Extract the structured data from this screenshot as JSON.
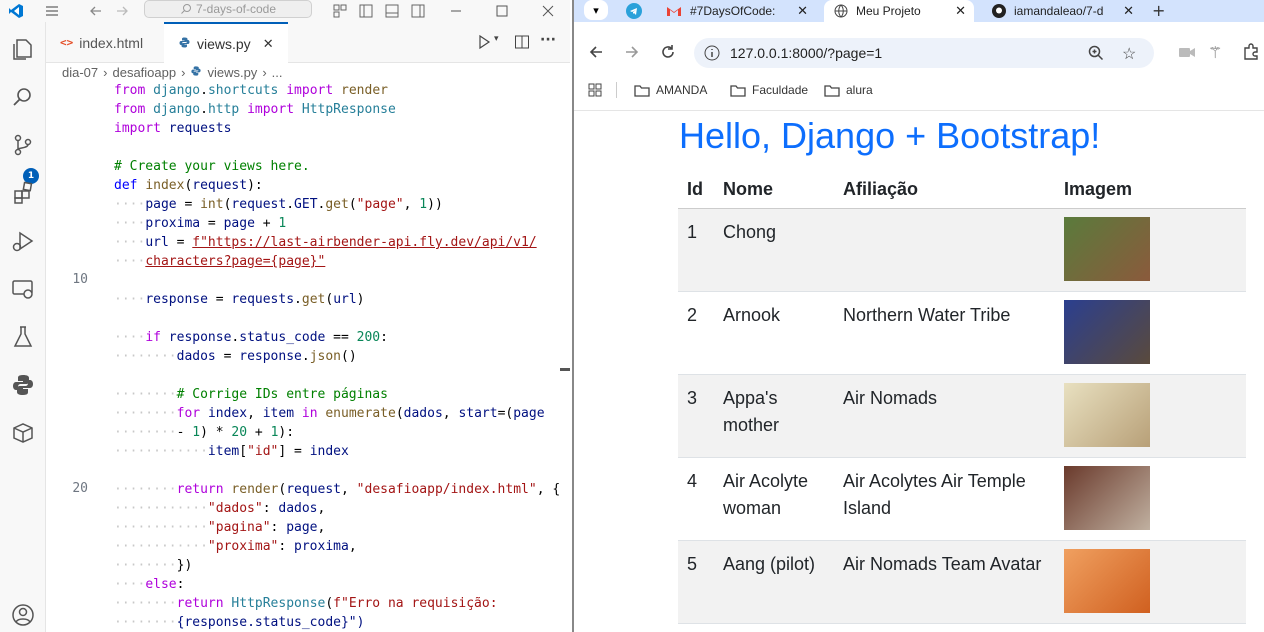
{
  "vscode": {
    "command_center": "7-days-of-code",
    "tabs": [
      {
        "label": "index.html",
        "icon": "html-file-icon"
      },
      {
        "label": "views.py",
        "icon": "python-file-icon"
      }
    ],
    "breadcrumb": [
      "dia-07",
      "desafioapp",
      "views.py",
      "..."
    ],
    "scm_badge": "1",
    "line_numbers": [
      {
        "label": "10"
      },
      {
        "label": "20"
      }
    ],
    "code_lines": [
      "from django.shortcuts import render",
      "from django.http import HttpResponse",
      "import requests",
      "",
      "# Create your views here.",
      "def index(request):",
      "    page = int(request.GET.get(\"page\", 1))",
      "    proxima = page + 1",
      "    url = f\"https://last-airbender-api.fly.dev/api/v1/",
      "    characters?page={page}\"",
      "",
      "    response = requests.get(url)",
      "",
      "    if response.status_code == 200:",
      "        dados = response.json()",
      "",
      "        # Corrige IDs entre páginas",
      "        for index, item in enumerate(dados, start=(page",
      "        - 1) * 20 + 1):",
      "            item[\"id\"] = index",
      "",
      "        return render(request, \"desafioapp/index.html\", {",
      "            \"dados\": dados,",
      "            \"pagina\": page,",
      "            \"proxima\": proxima,",
      "        })",
      "    else:",
      "        return HttpResponse(f\"Erro na requisição:",
      "        {response.status_code}\")"
    ]
  },
  "chrome": {
    "tabs": [
      {
        "label": "#7DaysOfCode: ",
        "icon": "gmail-icon"
      },
      {
        "label": "Meu Projeto",
        "icon": "globe-icon",
        "active": true
      },
      {
        "label": "iamandaleao/7-d",
        "icon": "github-icon"
      }
    ],
    "url": "127.0.0.1:8000/?page=1",
    "bookmarks": [
      {
        "label": "AMANDA"
      },
      {
        "label": "Faculdade"
      },
      {
        "label": "alura"
      }
    ]
  },
  "page": {
    "title": "Hello, Django + Bootstrap!",
    "table": {
      "headers": [
        "Id",
        "Nome",
        "Afiliação",
        "Imagem"
      ],
      "rows": [
        {
          "id": "1",
          "nome": "Chong",
          "afiliacao": "",
          "palette": [
            "#5a7b3c",
            "#8b5a3c"
          ]
        },
        {
          "id": "2",
          "nome": "Arnook",
          "afiliacao": "Northern Water Tribe",
          "palette": [
            "#2b3f8f",
            "#5a4a3c"
          ]
        },
        {
          "id": "3",
          "nome": "Appa's mother",
          "afiliacao": "Air Nomads",
          "palette": [
            "#e8e0c0",
            "#b8a078"
          ]
        },
        {
          "id": "4",
          "nome": "Air Acolyte woman",
          "afiliacao": "Air Acolytes Air Temple Island",
          "palette": [
            "#6a3a2c",
            "#c0b0a0"
          ]
        },
        {
          "id": "5",
          "nome": "Aang (pilot)",
          "afiliacao": "Air Nomads Team Avatar",
          "palette": [
            "#f0a060",
            "#d06020"
          ]
        }
      ]
    }
  }
}
